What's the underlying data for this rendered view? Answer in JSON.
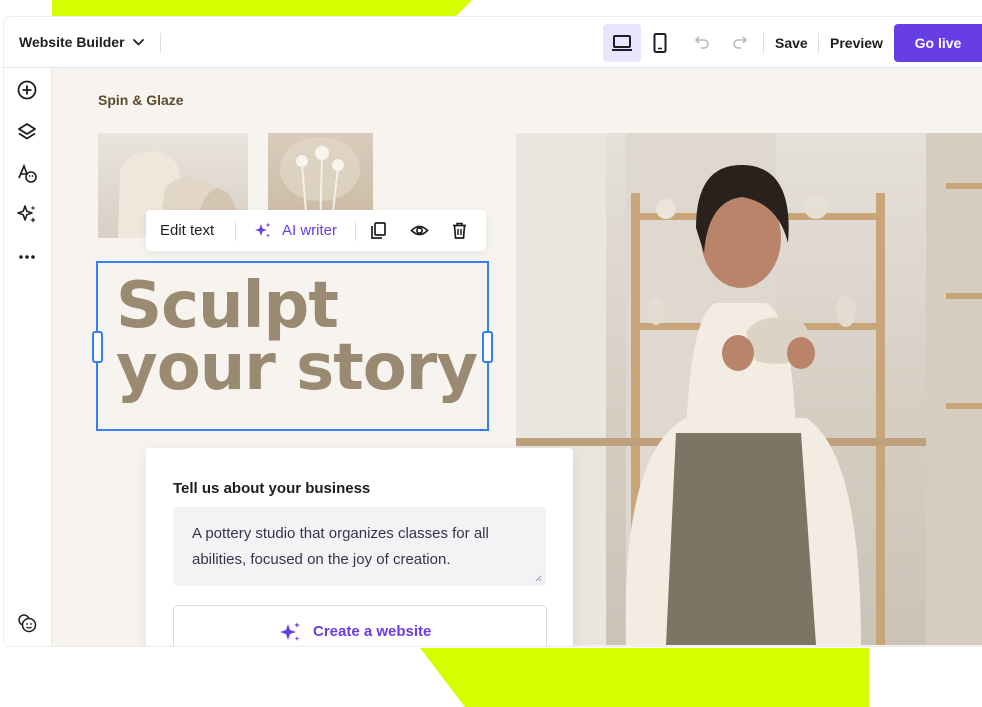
{
  "colors": {
    "brand_purple": "#673de6",
    "accent_lime": "#d5ff00",
    "selection_blue": "#357df9",
    "headline": "#9a8a72"
  },
  "topbar": {
    "app_title": "Website Builder",
    "icons": [
      "chevron-down-icon",
      "laptop-icon",
      "mobile-icon",
      "undo-icon",
      "redo-icon"
    ],
    "save_label": "Save",
    "preview_label": "Preview",
    "go_live_label": "Go live"
  },
  "sidebar": {
    "icons": [
      "add-element-icon",
      "layers-icon",
      "styles-icon",
      "ai-tools-icon",
      "more-icon",
      "help-icon"
    ]
  },
  "canvas": {
    "brand": "Spin & Glaze",
    "headline_line1": "Sculpt",
    "headline_line2": "your story",
    "toolbar": {
      "edit_text": "Edit text",
      "ai_writer": "AI writer",
      "icons": [
        "sparkle-icon",
        "duplicate-icon",
        "visibility-icon",
        "delete-icon"
      ]
    }
  },
  "prompt_card": {
    "title": "Tell us about your business",
    "description": "A pottery studio that organizes classes for all abilities, focused on the joy of creation.",
    "button_label": "Create a website"
  }
}
